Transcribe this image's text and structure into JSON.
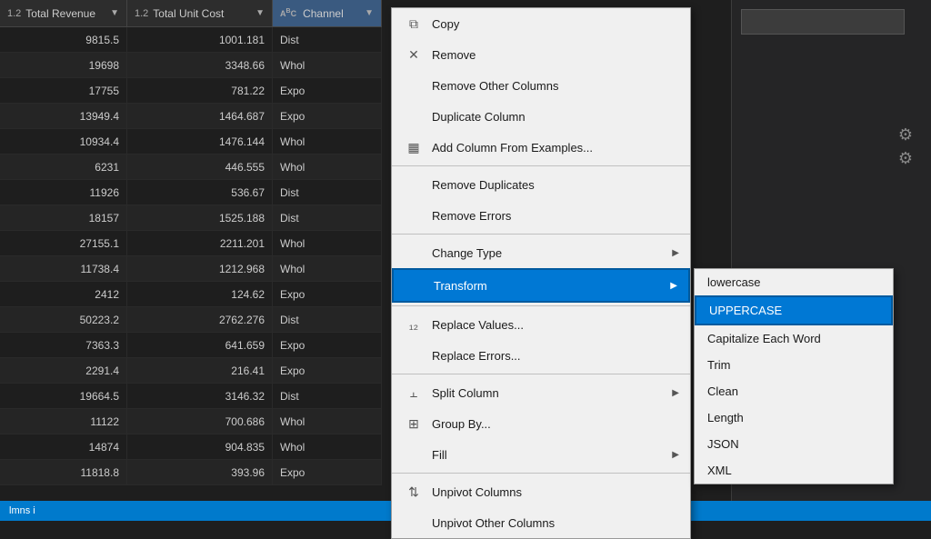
{
  "table": {
    "columns": [
      {
        "id": "revenue",
        "label": "Total Revenue",
        "type": "1.2",
        "typeColor": "#888"
      },
      {
        "id": "unit_cost",
        "label": "Total Unit Cost",
        "type": "1.2",
        "typeColor": "#888"
      },
      {
        "id": "channel",
        "label": "Channel",
        "type": "ABC",
        "typeColor": "#3a5a80"
      }
    ],
    "rows": [
      {
        "revenue": "9815.5",
        "unit_cost": "1001.181",
        "channel": "Dist"
      },
      {
        "revenue": "19698",
        "unit_cost": "3348.66",
        "channel": "Whol"
      },
      {
        "revenue": "17755",
        "unit_cost": "781.22",
        "channel": "Expo"
      },
      {
        "revenue": "13949.4",
        "unit_cost": "1464.687",
        "channel": "Expo"
      },
      {
        "revenue": "10934.4",
        "unit_cost": "1476.144",
        "channel": "Whol"
      },
      {
        "revenue": "6231",
        "unit_cost": "446.555",
        "channel": "Whol"
      },
      {
        "revenue": "11926",
        "unit_cost": "536.67",
        "channel": "Dist"
      },
      {
        "revenue": "18157",
        "unit_cost": "1525.188",
        "channel": "Dist"
      },
      {
        "revenue": "27155.1",
        "unit_cost": "2211.201",
        "channel": "Whol"
      },
      {
        "revenue": "11738.4",
        "unit_cost": "1212.968",
        "channel": "Whol"
      },
      {
        "revenue": "2412",
        "unit_cost": "124.62",
        "channel": "Expo"
      },
      {
        "revenue": "50223.2",
        "unit_cost": "2762.276",
        "channel": "Dist"
      },
      {
        "revenue": "7363.3",
        "unit_cost": "641.659",
        "channel": "Expo"
      },
      {
        "revenue": "2291.4",
        "unit_cost": "216.41",
        "channel": "Expo"
      },
      {
        "revenue": "19664.5",
        "unit_cost": "3146.32",
        "channel": "Dist"
      },
      {
        "revenue": "11122",
        "unit_cost": "700.686",
        "channel": "Whol"
      },
      {
        "revenue": "14874",
        "unit_cost": "904.835",
        "channel": "Whol"
      },
      {
        "revenue": "11818.8",
        "unit_cost": "393.96",
        "channel": "Expo"
      }
    ]
  },
  "context_menu": {
    "items": [
      {
        "id": "copy",
        "label": "Copy",
        "icon": "copy",
        "has_arrow": false
      },
      {
        "id": "remove",
        "label": "Remove",
        "icon": "remove",
        "has_arrow": false
      },
      {
        "id": "remove_other_columns",
        "label": "Remove Other Columns",
        "icon": null,
        "has_arrow": false
      },
      {
        "id": "duplicate_column",
        "label": "Duplicate Column",
        "icon": null,
        "has_arrow": false
      },
      {
        "id": "add_column_examples",
        "label": "Add Column From Examples...",
        "icon": "add_examples",
        "has_arrow": false
      },
      {
        "id": "sep1",
        "type": "separator"
      },
      {
        "id": "remove_duplicates",
        "label": "Remove Duplicates",
        "icon": null,
        "has_arrow": false
      },
      {
        "id": "remove_errors",
        "label": "Remove Errors",
        "icon": null,
        "has_arrow": false
      },
      {
        "id": "sep2",
        "type": "separator"
      },
      {
        "id": "change_type",
        "label": "Change Type",
        "icon": null,
        "has_arrow": true
      },
      {
        "id": "transform",
        "label": "Transform",
        "icon": null,
        "has_arrow": true,
        "active": true
      },
      {
        "id": "sep3",
        "type": "separator"
      },
      {
        "id": "replace_values",
        "label": "Replace Values...",
        "icon": "replace",
        "has_arrow": false
      },
      {
        "id": "replace_errors",
        "label": "Replace Errors...",
        "icon": null,
        "has_arrow": false
      },
      {
        "id": "sep4",
        "type": "separator"
      },
      {
        "id": "split_column",
        "label": "Split Column",
        "icon": "split",
        "has_arrow": true
      },
      {
        "id": "group_by",
        "label": "Group By...",
        "icon": "group",
        "has_arrow": false
      },
      {
        "id": "fill",
        "label": "Fill",
        "icon": null,
        "has_arrow": true
      },
      {
        "id": "sep5",
        "type": "separator"
      },
      {
        "id": "unpivot_columns",
        "label": "Unpivot Columns",
        "icon": "unpivot",
        "has_arrow": false
      },
      {
        "id": "unpivot_other_columns",
        "label": "Unpivot Other Columns",
        "icon": null,
        "has_arrow": false
      }
    ]
  },
  "submenu": {
    "items": [
      {
        "id": "lowercase",
        "label": "lowercase",
        "highlighted": false
      },
      {
        "id": "uppercase",
        "label": "UPPERCASE",
        "highlighted": true
      },
      {
        "id": "capitalize",
        "label": "Capitalize Each Word",
        "highlighted": false
      },
      {
        "id": "trim",
        "label": "Trim",
        "highlighted": false
      },
      {
        "id": "clean",
        "label": "Clean",
        "highlighted": false
      },
      {
        "id": "length",
        "label": "Length",
        "highlighted": false
      },
      {
        "id": "json",
        "label": "JSON",
        "highlighted": false
      },
      {
        "id": "xml",
        "label": "XML",
        "highlighted": false
      }
    ]
  },
  "bottom_bar": {
    "text": "lmns i"
  }
}
